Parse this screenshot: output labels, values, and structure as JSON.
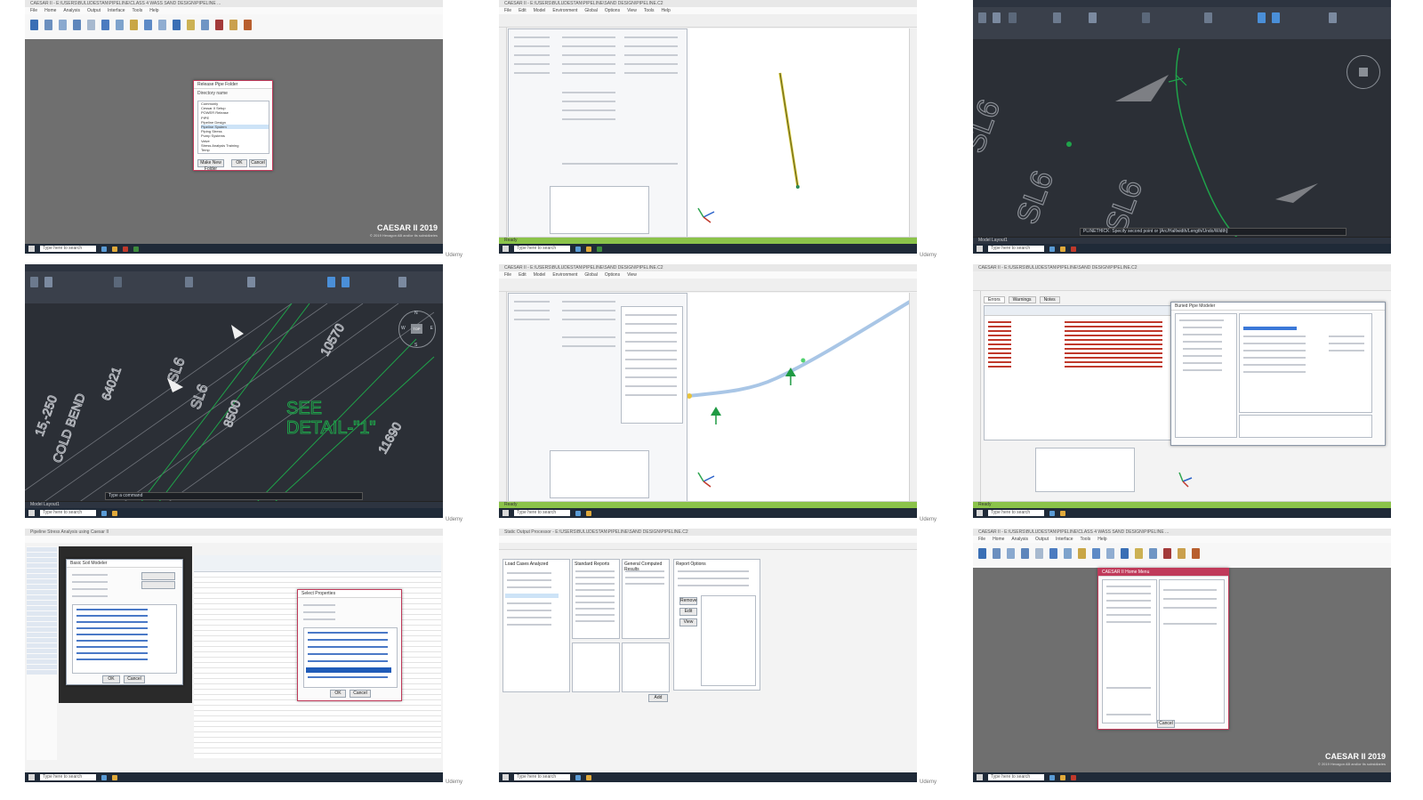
{
  "gallery_label": "Udemy",
  "taskbar": {
    "search_placeholder": "Type here to search"
  },
  "tiles": {
    "t0": {
      "window_title": "CAESAR II - E:\\USERS\\BULUDESTAN\\PIPELINE\\CLASS 4 WASS SAND DESIGN\\PIPELINE ...",
      "menu": [
        "File",
        "Home",
        "Analysis",
        "Output",
        "Interface",
        "Tools",
        "Help"
      ],
      "dialog_title": "Release Pipe Folder",
      "dialog_heading": "Directory name",
      "tree_items": [
        "Commonly",
        "Cessar II Setup",
        "POWER Release",
        "PIPE",
        "Pipeline Design",
        "Pipeline System",
        "Piping Stress",
        "Pump Systems",
        "Valve",
        "Stress Analysis Training",
        "Temp"
      ],
      "buttons": [
        "Make New Folder",
        "OK",
        "Cancel"
      ],
      "brand": "CAESAR II 2019",
      "brand_sub": "© 2019 Hexagon AB and/or its subsidiaries"
    },
    "t1": {
      "window_title": "CAESAR II - E:\\USERS\\BULUDESTAN\\PIPELINE\\SAND DESIGN\\PIPELINE.C2",
      "menu": [
        "File",
        "Edit",
        "Model",
        "Environment",
        "Global",
        "Options",
        "View",
        "Tools",
        "Help"
      ],
      "status": "Ready"
    },
    "t2": {
      "command_prompt": "PLINETHICK: Specify second point or [Arc/Halfwidth/Length/Undo/Width]:",
      "drawing_labels": [
        "SL6",
        "SL6",
        "SL6"
      ],
      "layout_tabs": [
        "Model",
        "Layout1"
      ]
    },
    "t3": {
      "drawing_text": [
        "SEE",
        "DETAIL-\"1\"",
        "COLD BEND",
        "SL6",
        "8500",
        "64021",
        "15,-250",
        "SL6",
        "11690",
        "10570"
      ],
      "command_prompt": "Type a command",
      "layout_tabs": [
        "Model",
        "Layout1"
      ],
      "compass": [
        "N",
        "W",
        "E",
        "S",
        "TOP"
      ]
    },
    "t4": {
      "status": "Ready"
    },
    "t5": {
      "tabs": [
        "Errors",
        "Warnings",
        "Notes"
      ],
      "panel_title": "Buried Pipe Modeler",
      "status": "Ready"
    },
    "t6": {
      "explorer_title": "Pipeline Stress Analysis using Caesar II",
      "dialog_title": "Select Properties",
      "sub_dialog_title": "Basic Soil Modeler",
      "buttons": [
        "OK",
        "Cancel"
      ]
    },
    "t7": {
      "window_title": "Static Output Processor - E:\\USERS\\BULUDESTAN\\PIPELINE\\SAND DESIGN\\PIPELINE.C2",
      "sections": [
        "Load Cases Analyzed",
        "Standard Reports",
        "General Computed Results",
        "Report Options"
      ],
      "buttons": [
        "Add",
        "Remove",
        "Edit",
        "View"
      ]
    },
    "t8": {
      "dialog_title": "CAESAR II Home Menu",
      "buttons": [
        "Cancel"
      ],
      "brand": "CAESAR II 2019",
      "brand_sub": "© 2019 Hexagon AB and/or its subsidiaries"
    }
  },
  "colors": {
    "taskbar": "#1f2a38",
    "cad_background": "#2b2f36",
    "dialog_border": "#c03a5a",
    "pipe_yellow": "#d4c63a",
    "pipe_blue": "#a9c6e6",
    "cad_green": "#1fa34a"
  },
  "icons": [
    "windows-icon",
    "search-icon",
    "folder-icon",
    "gear-icon",
    "compass-icon",
    "axis-triad-icon"
  ]
}
